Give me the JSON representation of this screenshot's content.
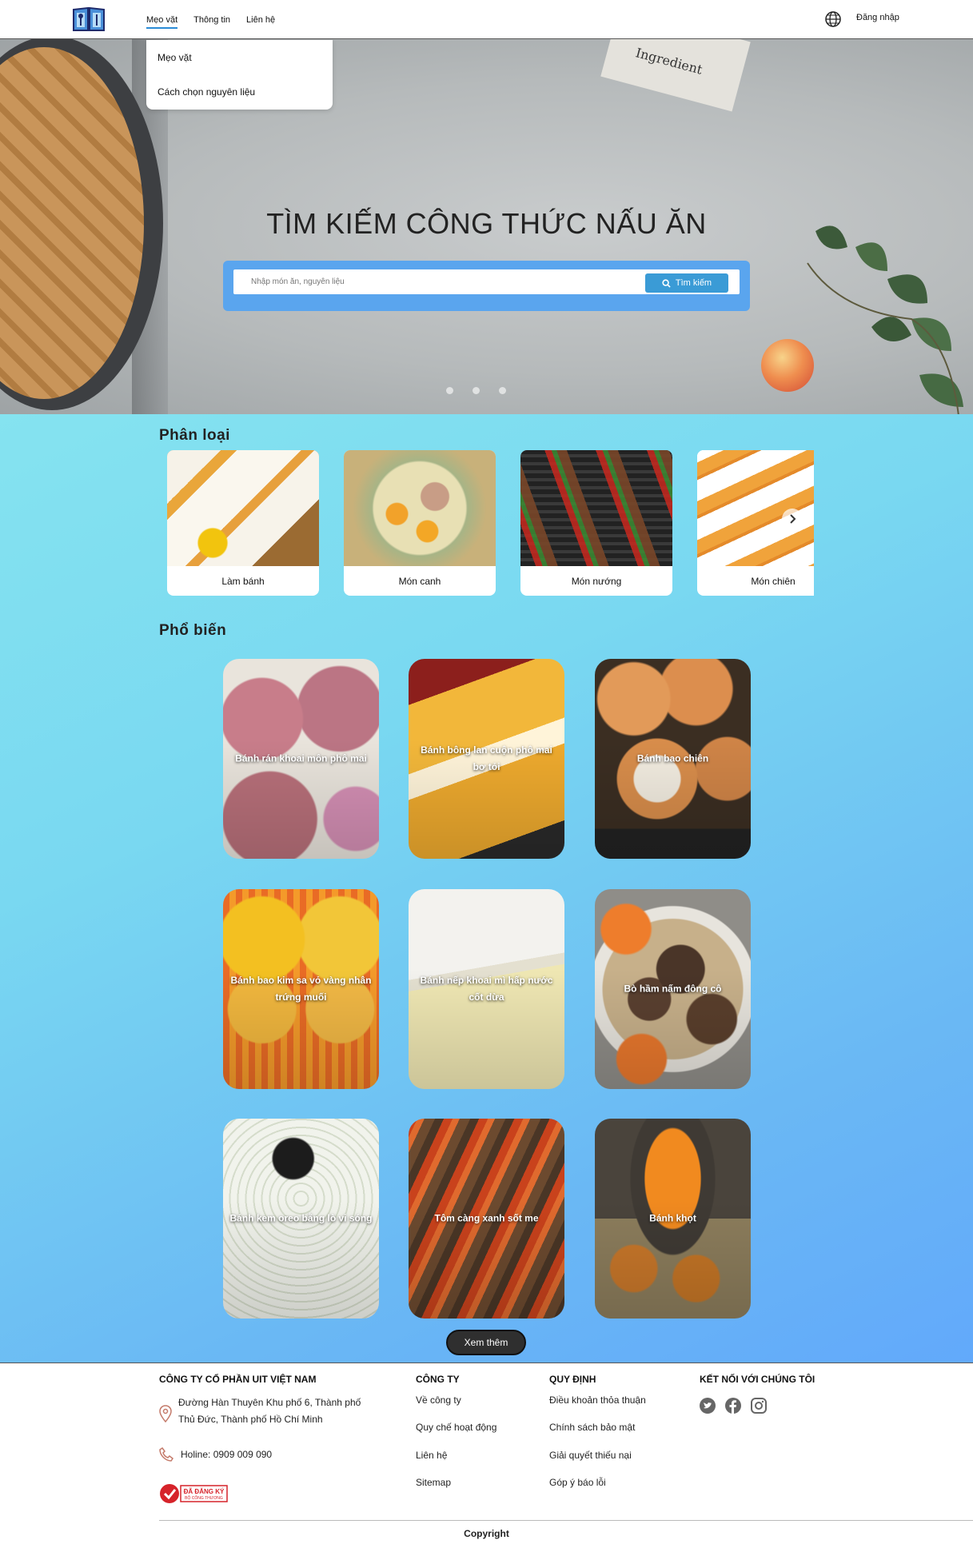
{
  "header": {
    "nav": [
      "Mẹo vặt",
      "Thông tin",
      "Liên hệ"
    ],
    "login": "Đăng nhập",
    "dropdown": [
      "Mẹo vặt",
      "Cách chọn nguyên liệu"
    ]
  },
  "hero": {
    "title": "TÌM KIẾM CÔNG THỨC NẤU ĂN",
    "placeholder": "Nhập món ăn, nguyên liệu",
    "search_label": "Tìm kiếm",
    "paper_text": "Ingredient"
  },
  "categories": {
    "title": "Phân loại",
    "items": [
      "Làm bánh",
      "Món canh",
      "Món nướng",
      "Món chiên"
    ]
  },
  "popular": {
    "title": "Phổ biến",
    "items": [
      "Bánh rán khoai môn phô mai",
      "Bánh bông lan cuộn phô mai bơ tỏi",
      "Bánh bao chiên",
      "Bánh bao kim sa vỏ vàng nhân trứng muối",
      "Bánh nếp khoai mì hấp nước cốt dừa",
      "Bò hầm nấm đông cô",
      "Bánh kem oreo bằng lò vi sóng",
      "Tôm càng xanh sốt me",
      "Bánh khọt"
    ],
    "more": "Xem thêm"
  },
  "footer": {
    "company_name": "CÔNG TY CỔ PHẦN UIT VIỆT NAM",
    "address_line1": "Đường Hàn Thuyên Khu phố 6, Thành phố",
    "address_line2": "Thủ Đức, Thành phố Hồ Chí Minh",
    "hotline": "Holine: 0909 009 090",
    "badge_line1": "ĐÃ ĐĂNG KÝ",
    "badge_line2": "BỘ CÔNG THƯƠNG",
    "col_company": "CÔNG TY",
    "company_links": [
      "Về công ty",
      "Quy chế hoạt động",
      "Liên hệ",
      "Sitemap"
    ],
    "col_rules": "QUY ĐỊNH",
    "rules_links": [
      "Điều khoản thỏa thuận",
      "Chính sách bảo mật",
      "Giải quyết thiếu nại",
      "Góp ý báo lỗi"
    ],
    "col_connect": "KẾT NỐI VỚI CHÚNG TÔI",
    "copyright": "Copyright"
  }
}
